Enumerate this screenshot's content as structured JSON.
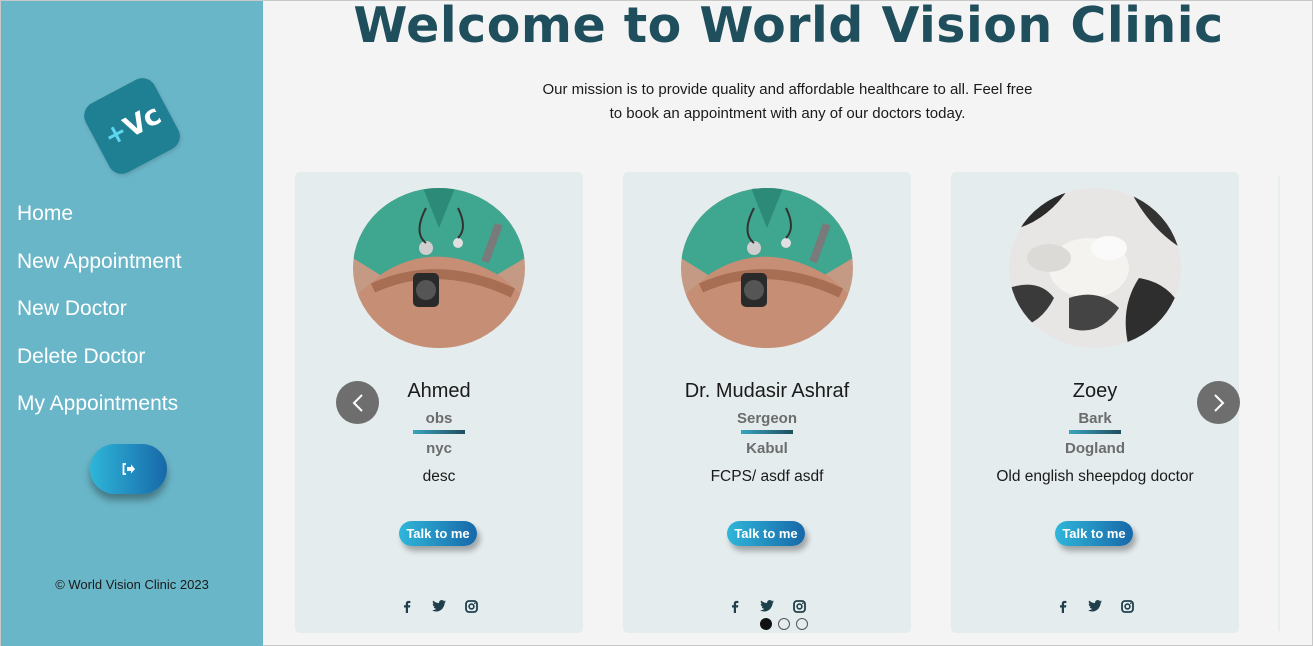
{
  "sidebar": {
    "logo_text": "Vc",
    "logo_plus": "+",
    "nav": [
      {
        "label": "Home"
      },
      {
        "label": "New Appointment"
      },
      {
        "label": "New Doctor"
      },
      {
        "label": "Delete Doctor"
      },
      {
        "label": "My Appointments"
      }
    ],
    "logout_icon": "sign-out-icon",
    "copyright": "© World Vision Clinic 2023"
  },
  "main": {
    "title": "Welcome to World Vision Clinic",
    "mission_line1": "Our mission is to provide quality and affordable healthcare to all. Feel free",
    "mission_line2": "to book an appointment with any of our doctors today."
  },
  "doctors": [
    {
      "name": "Ahmed",
      "specialization": "obs",
      "city": "nyc",
      "description": "desc",
      "button": "Talk to me",
      "photo": "doctor-photo"
    },
    {
      "name": "Dr. Mudasir Ashraf",
      "specialization": "Sergeon",
      "city": "Kabul",
      "description": "FCPS/ asdf asdf",
      "button": "Talk to me",
      "photo": "doctor-photo"
    },
    {
      "name": "Zoey",
      "specialization": "Bark",
      "city": "Dogland",
      "description": "Old english sheepdog doctor",
      "button": "Talk to me",
      "photo": "dog-photo"
    }
  ],
  "carousel": {
    "page_count": 3,
    "active_page": 1
  },
  "colors": {
    "sidebar_bg": "#6ab6c9",
    "title": "#1f4e5c",
    "card_bg": "#e4ecee",
    "button_gradient_start": "#2fb6d9",
    "button_gradient_end": "#1768a8"
  }
}
